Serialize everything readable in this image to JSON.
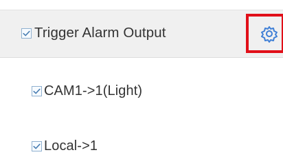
{
  "alarm_linkage": {
    "header": {
      "checked": true,
      "label": "Trigger Alarm Output",
      "settings_icon": "gear-icon"
    },
    "outputs": [
      {
        "checked": true,
        "label": "CAM1->1(Light)"
      },
      {
        "checked": true,
        "label": "Local->1"
      }
    ]
  },
  "colors": {
    "header_background": "#f0f0f0",
    "checkbox_border": "#8fb0cf",
    "check_mark": "#4b7fb3",
    "highlight_border": "#e10f19",
    "gear_icon": "#3f7fd6",
    "text": "#333333"
  }
}
